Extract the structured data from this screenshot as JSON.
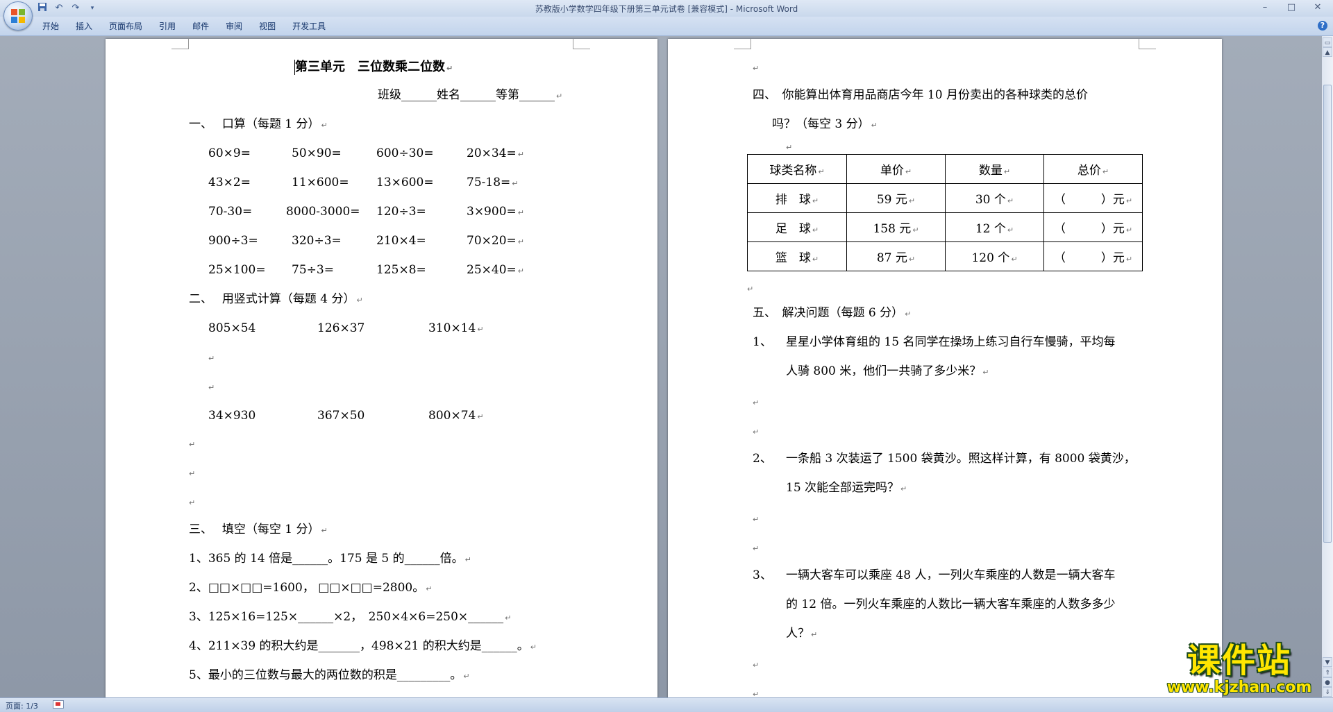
{
  "window": {
    "title": "苏教版小学数学四年级下册第三单元试卷 [兼容模式] - Microsoft Word",
    "qat_icons": [
      "save-icon",
      "undo-icon",
      "redo-icon",
      "customize-icon"
    ],
    "controls": {
      "minimize": "–",
      "maximize": "□",
      "close": "✕"
    }
  },
  "ribbon": {
    "tabs": [
      "开始",
      "插入",
      "页面布局",
      "引用",
      "邮件",
      "审阅",
      "视图",
      "开发工具"
    ],
    "help": "?"
  },
  "page1": {
    "title": "第三单元　三位数乘二位数",
    "header_line": "班级______姓名______等第______",
    "sec1": {
      "heading": "一、　 口算（每题 1 分）",
      "rows": [
        [
          "60×9=",
          "50×90=",
          "600÷30=",
          "20×34="
        ],
        [
          "43×2=",
          "11×600=",
          "13×600=",
          "75-18="
        ],
        [
          "70-30=",
          "8000-3000=",
          "120÷3=",
          "3×900="
        ],
        [
          "900÷3=",
          "320÷3=",
          "210×4=",
          "70×20="
        ],
        [
          "25×100=",
          "75÷3=",
          "125×8=",
          "25×40="
        ]
      ]
    },
    "sec2": {
      "heading": "二、　 用竖式计算（每题 4 分）",
      "rows": [
        [
          "805×54",
          "126×37",
          "310×14"
        ],
        [
          "34×930",
          "367×50",
          "800×74"
        ]
      ]
    },
    "sec3": {
      "heading": "三、　 填空（每空 1 分）",
      "items": [
        "1、365 的 14 倍是______。175 是 5 的______倍。",
        "2、□□×□□=1600， □□×□□=2800。",
        "3、125×16=125×______×2，　250×4×6=250×______",
        "4、211×39 的积大约是_______，498×21 的积大约是______。",
        "5、最小的三位数与最大的两位数的积是_________。"
      ]
    }
  },
  "page2": {
    "sec4": {
      "heading": "四、　你能算出体育用品商店今年 10 月份卖出的各种球类的总价",
      "heading_cont": "吗？（每空 3 分）",
      "table": {
        "headers": [
          "球类名称",
          "单价",
          "数量",
          "总价"
        ],
        "rows": [
          [
            "排　球",
            "59 元",
            "30 个",
            "（　　　）元"
          ],
          [
            "足　球",
            "158 元",
            "12 个",
            "（　　　）元"
          ],
          [
            "篮　球",
            "87 元",
            "120 个",
            "（　　　）元"
          ]
        ]
      }
    },
    "sec5": {
      "heading": "五、　解决问题（每题 6 分）",
      "q1_num": "1、",
      "q1_line1": "星星小学体育组的 15 名同学在操场上练习自行车慢骑，平均每",
      "q1_line2": "人骑 800 米，他们一共骑了多少米？",
      "q2_num": "2、",
      "q2_line1": "一条船 3 次装运了 1500 袋黄沙。照这样计算，有 8000 袋黄沙，",
      "q2_line2": "15 次能全部运完吗？",
      "q3_num": "3、",
      "q3_line1": "一辆大客车可以乘座 48 人，一列火车乘座的人数是一辆大客车",
      "q3_line2": "的 12 倍。一列火车乘座的人数比一辆大客车乘座的人数多多少",
      "q3_line3": "人？"
    }
  },
  "marks": {
    "para": "↵"
  },
  "statusbar": {
    "page_count": "页面: 1/3"
  },
  "watermark": {
    "main": "课件站",
    "url": "www.kjzhan.com"
  },
  "colors": {
    "yellow": "#ffe600",
    "ribbon": "#c2d4ec",
    "workspace": "#9aa3b1"
  }
}
